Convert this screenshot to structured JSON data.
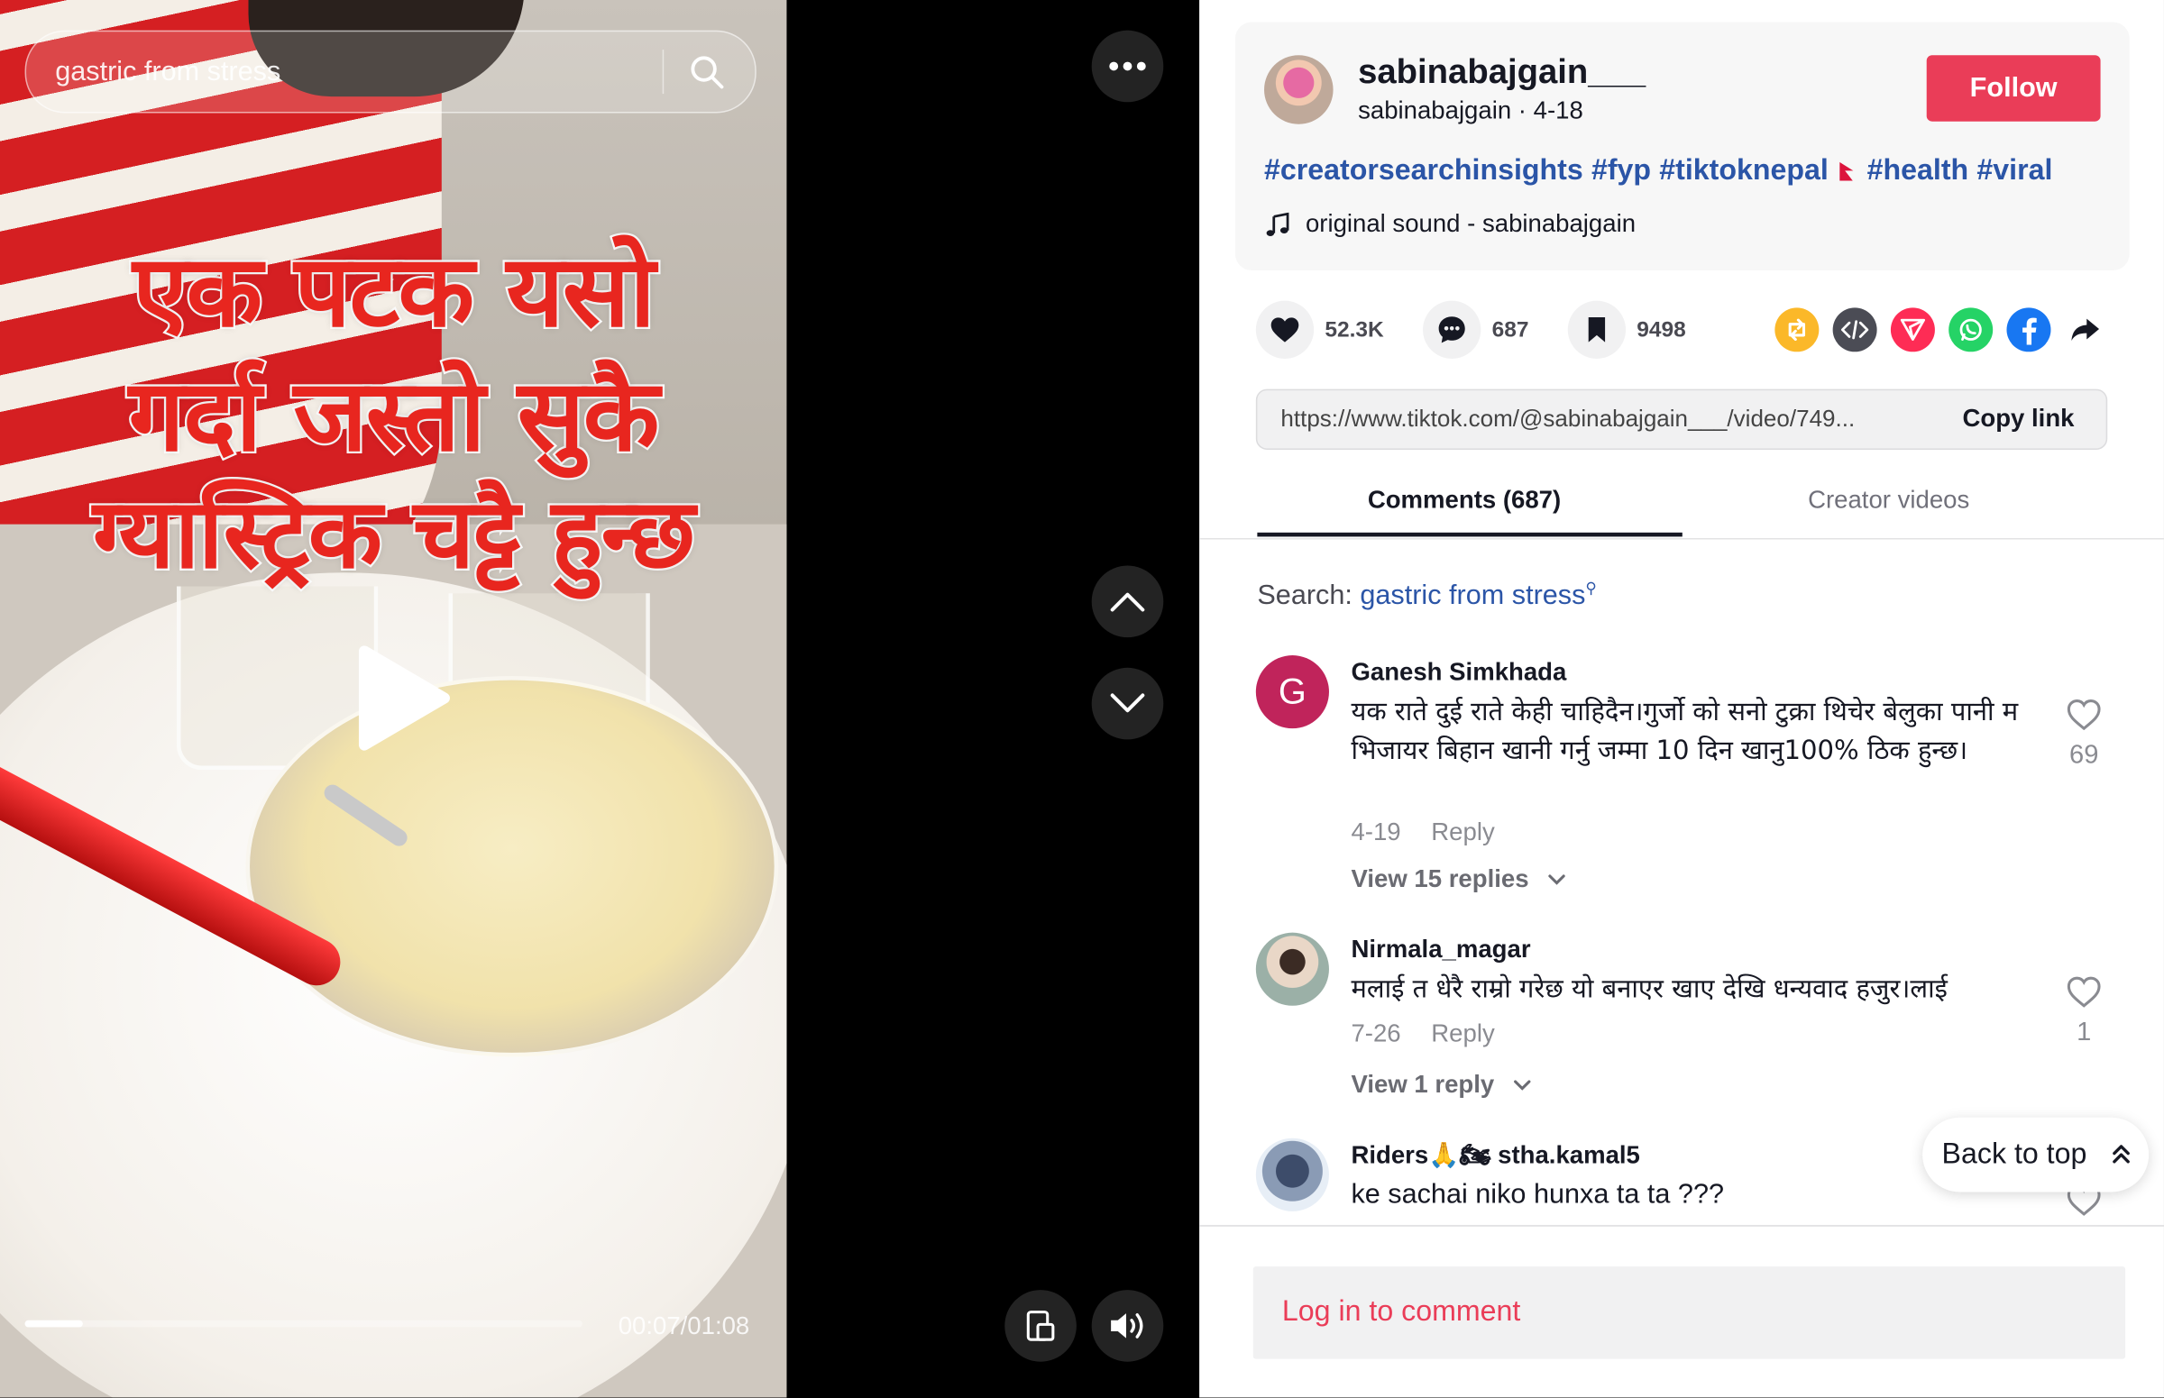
{
  "video": {
    "search_query": "gastric from stress",
    "overlay_line1": "एक पटक यसो",
    "overlay_line2": "गर्दा जस्तो सुकै",
    "overlay_line3": "ग्यास्ट्रिक चट्टै हुन्छ",
    "time": "00:07/01:08",
    "progress": 0.103
  },
  "post": {
    "display_name": "sabinabajgain___",
    "subline": "sabinabajgain · 4-18",
    "follow_label": "Follow",
    "hashtags": [
      "#creatorsearchinsights",
      "#fyp",
      "#tiktoknepal",
      "#health",
      "#viral"
    ],
    "sound": "original sound - sabinabajgain"
  },
  "stats": {
    "likes": "52.3K",
    "comments": "687",
    "saves": "9498"
  },
  "share": {
    "icons": [
      "repost-icon",
      "embed-icon",
      "send-icon",
      "whatsapp-icon",
      "facebook-icon",
      "share-arrow-icon"
    ],
    "colors": {
      "repost": "#fbb829",
      "embed": "#4b4c55",
      "send": "#fe2c55",
      "whatsapp": "#25d366",
      "facebook": "#1877f2"
    }
  },
  "link": {
    "url": "https://www.tiktok.com/@sabinabajgain___/video/749...",
    "copy_label": "Copy link"
  },
  "tabs": {
    "comments": "Comments (687)",
    "creator_videos": "Creator videos"
  },
  "search": {
    "label": "Search: ",
    "term": "gastric from stress"
  },
  "comments": [
    {
      "avatar_letter": "G",
      "name": "Ganesh Simkhada",
      "text": "यक राते दुई राते केही चाहिदैन।गुर्जो को सनो टुक्रा थिचेर बेलुका पानी म भिजायर बिहान खानी गर्नु जम्मा 10 दिन खानु100% ठिक हुन्छ।",
      "date": "4-19",
      "reply_label": "Reply",
      "view_replies": "View 15 replies",
      "likes": "69"
    },
    {
      "name": "Nirmala_magar",
      "text": "मलाई त धेरै राम्रो गरेछ यो बनाएर खाए देखि धन्यवाद हजुर।लाई",
      "date": "7-26",
      "reply_label": "Reply",
      "view_replies": "View 1 reply",
      "likes": "1"
    },
    {
      "name": "Riders🙏🏍 stha.kamal5",
      "text": "ke sachai niko hunxa ta ta ???"
    }
  ],
  "back_to_top": "Back to top",
  "login_prompt": "Log in to comment",
  "colors": {
    "accent": "#ea3d58",
    "link_blue": "#2b55a7",
    "text_dark": "#161823"
  }
}
